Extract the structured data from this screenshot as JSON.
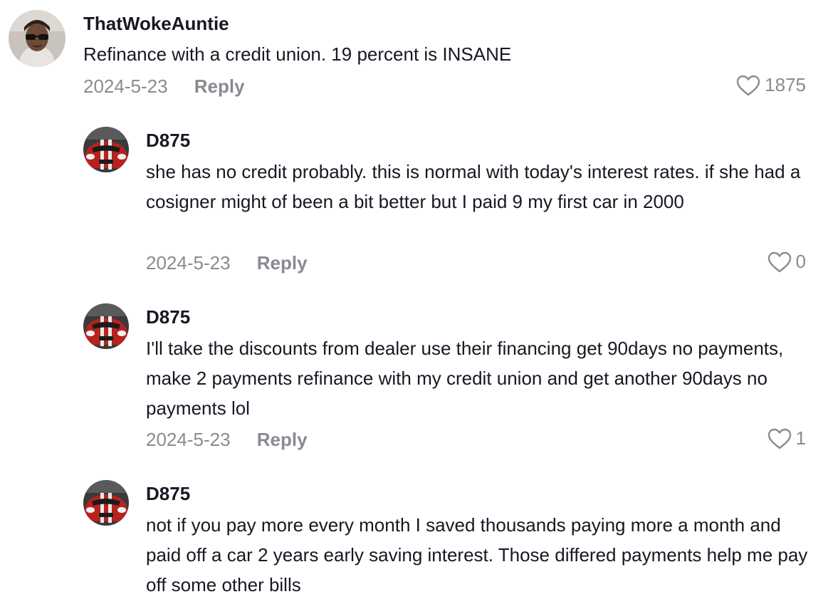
{
  "comments": [
    {
      "username": "ThatWokeAuntie",
      "text": "Refinance with a credit union. 19 percent is INSANE",
      "date": "2024-5-23",
      "reply_label": "Reply",
      "likes": "1875",
      "avatar_icon": "woman-sunglasses-avatar"
    },
    {
      "username": "D875",
      "text": "she has no credit probably. this is normal with today's interest rates. if she had a cosigner might of been a bit better but I paid 9 my first car in 2000",
      "date": "2024-5-23",
      "reply_label": "Reply",
      "likes": "0",
      "avatar_icon": "red-sports-car-avatar"
    },
    {
      "username": "D875",
      "text": "I'll take the discounts from dealer use their financing get 90days no payments, make 2 payments refinance with my credit union and get another 90days no payments lol",
      "date": "2024-5-23",
      "reply_label": "Reply",
      "likes": "1",
      "avatar_icon": "red-sports-car-avatar"
    },
    {
      "username": "D875",
      "text": "not if you pay more every month I saved thousands paying more a month and paid off a car 2 years early saving interest. Those differed payments help me pay off some other bills",
      "avatar_icon": "red-sports-car-avatar"
    }
  ],
  "colors": {
    "text": "#161823",
    "secondary": "#8a8b91",
    "car_red": "#b8221e",
    "background": "#ffffff"
  }
}
